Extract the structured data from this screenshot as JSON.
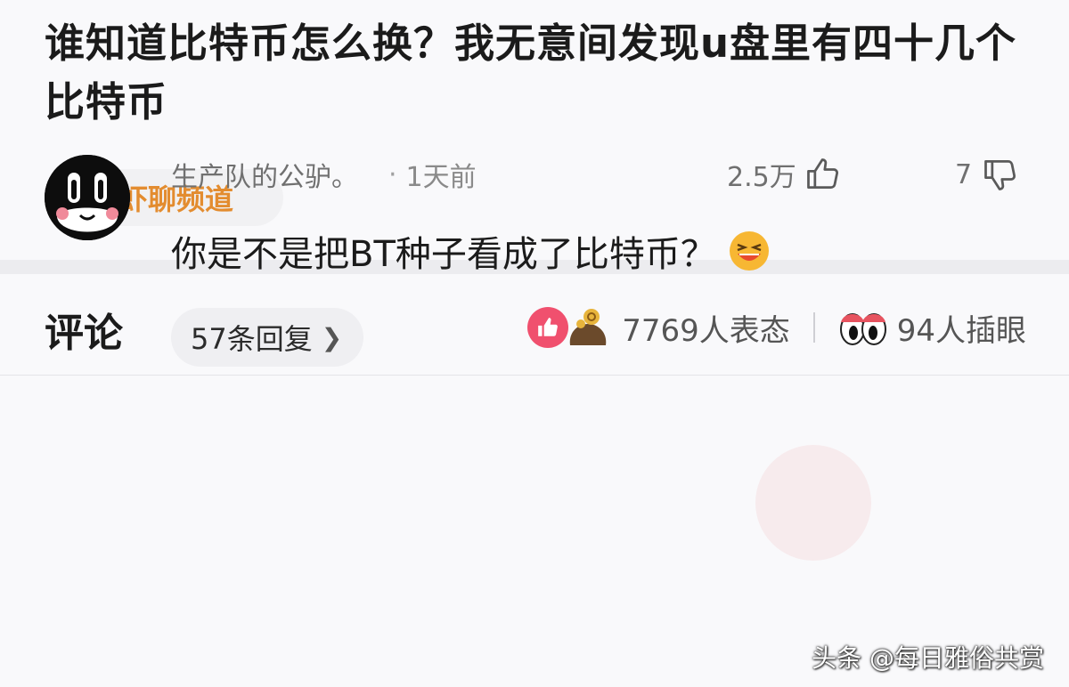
{
  "post": {
    "title": "谁知道比特币怎么换？我无意间发现u盘里有四十几个比特币",
    "channel": {
      "name": "虾聊频道",
      "icon": "clover-icon"
    }
  },
  "comments": {
    "title": "评论",
    "reactions": {
      "count_text": "7769人表态",
      "eyes_text": "94人插眼",
      "like_icon": "thumbs-up-icon",
      "coin_icon": "coin-bag-icon",
      "eyes_icon": "eyes-icon"
    },
    "items": [
      {
        "user": "生产队的公驴。",
        "dot": "·",
        "time": "1天前",
        "likes": "2.5万",
        "dislikes": "7",
        "text": "你是不是把BT种子看成了比特币？",
        "emoji": "laughing-face-icon",
        "replies": "57条回复"
      }
    ]
  },
  "watermark": "头条 @每日雅俗共赏",
  "colors": {
    "accent_orange": "#e38c2f",
    "like_red": "#f0506e",
    "text_dark": "#1b1b1b",
    "text_gray": "#707070"
  }
}
